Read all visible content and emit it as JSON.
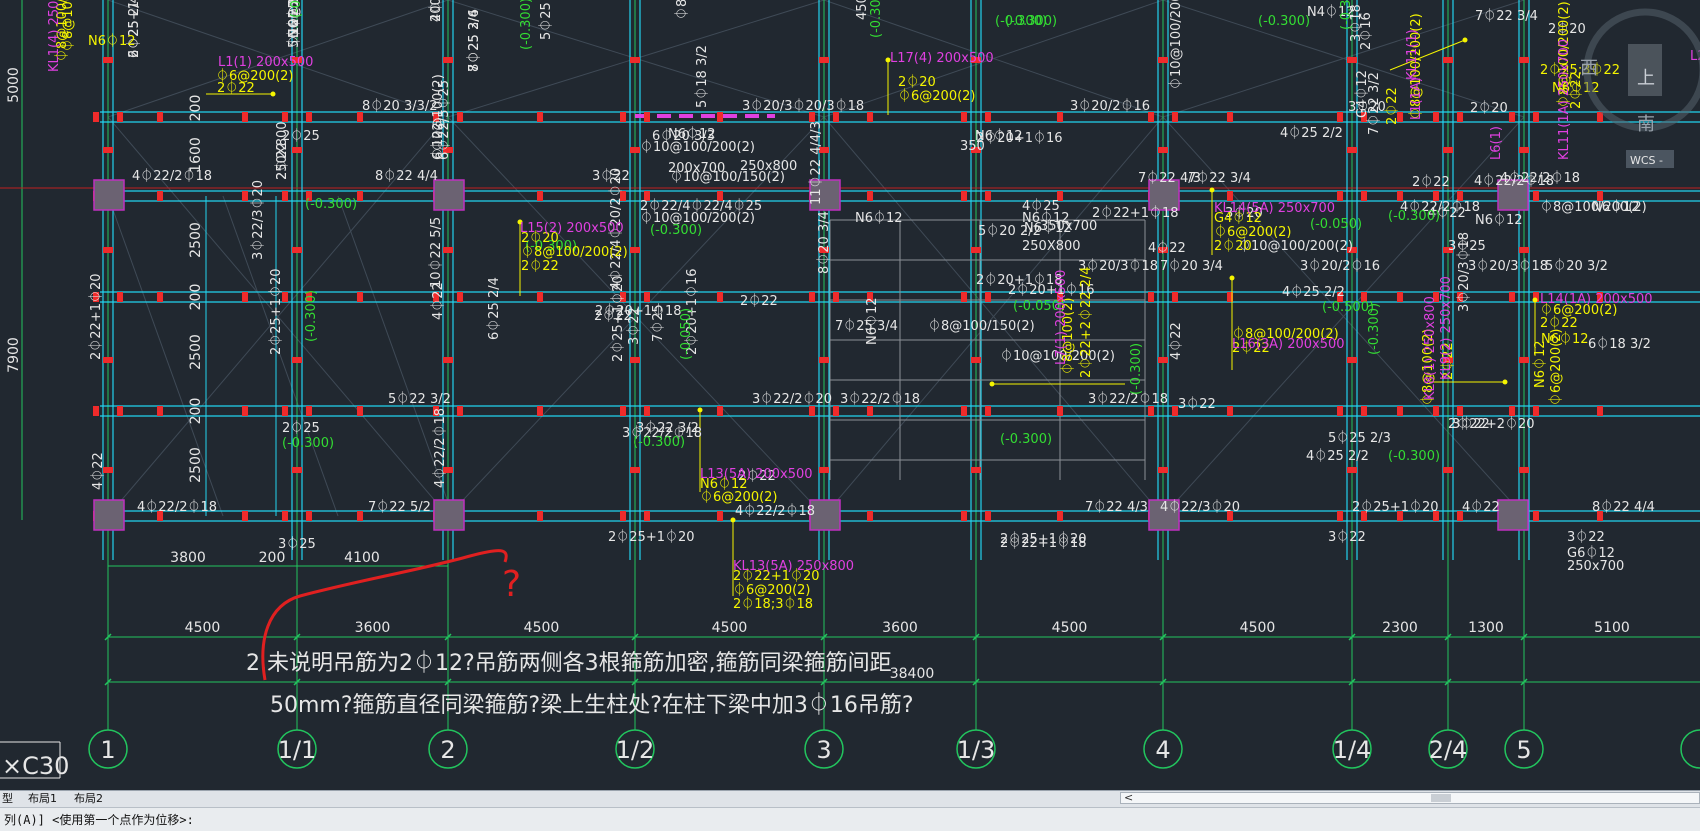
{
  "colors": {
    "bg": "#212830",
    "grid": "#22c55e",
    "beam": "#22d3ee",
    "rebar": "#ef2b2b",
    "column": "#6b6272",
    "column_border": "#c030c0",
    "white": "#e6e6e6",
    "green": "#33dd33",
    "yellow": "#f5f500",
    "magenta": "#e040e0",
    "annot": "#e02020"
  },
  "axes": {
    "labels": [
      "1",
      "1/1",
      "2",
      "1/2",
      "3",
      "1/3",
      "4",
      "1/4",
      "2/4",
      "5"
    ],
    "dims_bottom": [
      "4500",
      "3600",
      "4500",
      "4500",
      "3600",
      "4500",
      "4500",
      "2300",
      "1300",
      "5100"
    ],
    "total": "38400",
    "dims_mid": [
      "3800",
      "200",
      "4100"
    ],
    "left_dims": [
      "5000",
      "7900"
    ],
    "inner_dims": [
      "200",
      "1600",
      "2500",
      "200",
      "2500",
      "200",
      "2500"
    ]
  },
  "concrete": "×C30",
  "note": {
    "line1": "2.未说明吊筋为2⏀12?吊筋两侧各3根箍筋加密,箍筋同梁箍筋间距",
    "line2": "50mm?箍筋直径同梁箍筋?梁上生柱处?在柱下梁中加3⏀16吊筋?"
  },
  "handwriting": "?",
  "viewcube": {
    "west": "西",
    "south": "南",
    "up": "上",
    "wcs": "WCS -"
  },
  "rebar_labels": {
    "white": [
      "2⏀25+1⏀22",
      "5⏀25 2/3",
      "4⏀22",
      "8⏀25 2/6",
      "6⏀22",
      "5⏀25 2/3",
      "2⏀22",
      "8⏀20 3/3/2",
      "2⏀25",
      "4⏀22/2⏀18",
      "8⏀22 4/4",
      "6⏀22/5⏀25",
      "3⏀22",
      "6⏀20 3/3",
      "3⏀20/3⏀20/3⏀18",
      "5⏀18 3/2",
      "2⏀20+1⏀16",
      "350",
      "3⏀20/2⏀16",
      "7⏀22 4/3",
      "4⏀22/2⏀18",
      "7⏀22 3/4",
      "10⏀22 5/5",
      "3⏀22/3⏀20",
      "2⏀22/4⏀22/4⏀25",
      "11⏀22 4/4/3",
      "4⏀25",
      "N6⏀12",
      "250X800",
      "3⏀20/3⏀18",
      "7⏀20 3/4",
      "3⏀20/2⏀16",
      "5⏀20 3/2",
      "3⏀20/3⏀18",
      "2⏀22+1⏀20",
      "2⏀22",
      "4⏀22",
      "2⏀20+1⏀18",
      "2⏀20+1⏀16",
      "4⏀25 2/2",
      "6⏀18 3/2",
      "5⏀22 3/2",
      "2⏀25",
      "6⏀25 2/4",
      "7⏀25",
      "3⏀22",
      "3⏀22/2⏀20",
      "7⏀25 3/4",
      "3⏀22/2⏀18",
      "3⏀22/2⏀18",
      "3⏀22",
      "3⏀22",
      "2⏀22+2⏀20",
      "4⏀22",
      "4⏀22/2⏀18",
      "7⏀22 5/2",
      "4⏀22/2⏀18",
      "7⏀22 4/3",
      "4⏀22/2⏀18",
      "4⏀22/3⏀20",
      "5⏀25 2/3",
      "4⏀25 2/2",
      "3⏀25",
      "2⏀25+1⏀20",
      "2⏀22+1⏀18",
      "3⏀22",
      "4⏀22",
      "8⏀22 4/4",
      "3⏀22",
      "G6⏀12",
      "250x700",
      "2⏀20",
      "N6⏀12",
      "4⏀22/2⏀18",
      "N4⏀12",
      "3⏀18",
      "2⏀16",
      "G4⏀12",
      "3⏀20",
      "7⏀22 3/2",
      "⏀10@100/200(2)",
      "N6⏀12",
      "200x700",
      "⏀10@100/150(2)",
      "⏀10@100/200(2)",
      "⏀10@100/200(2)",
      "N6⏀12",
      "250x800",
      "4⏀22/4⏀20/2⏀20",
      "2⏀20+1⏀18",
      "3⏀22 3/2",
      "2⏀22",
      "2⏀22",
      "3⏀22/2⏀18",
      "2⏀25+1⏀20",
      "3⏀25",
      "2⏀22",
      "⏀10@100/200(2)",
      "8⏀20 3/4",
      "4⏀22",
      "3⏀20/3⏀18",
      "4⏀22",
      "2⏀25+1⏀20",
      "2⏀25+1⏀20",
      "2⏀25+1⏀20",
      "4⏀22/2⏀18",
      "2⏀22+1⏀18",
      "3⏀20",
      "4⏀22",
      "⏀8@100/200(2)",
      "N6⏀12",
      "4⏀25 2/2",
      "7⏀22 3/4",
      "2⏀20",
      "N6⏀12",
      "5⏀20 2/2",
      "N6⏀12",
      "5⏀25 2/3",
      "⏀8@100/200(4)",
      "450x700",
      "2⏀20+1⏀16",
      "⏀10@100/200(2)",
      "N6⏀12",
      "⏀8@100/150(2)",
      "350x700",
      "6⏀25 2/4",
      "⏀10@100/200(2)",
      "200x500",
      "7⏀25 3/4",
      "⏀10@100(2)",
      "N6⏀12",
      "250X800"
    ],
    "green": [
      "(-0.300)",
      "(-0.300)",
      "(-0.300)",
      "(-0.300)",
      "(-0.300)",
      "(-0.300)",
      "(-0.300)",
      "(-0.050)",
      "(-0.300)",
      "(-0.300)",
      "(-0.300)",
      "(-0.050)",
      "(-0.300)",
      "(-0.300)",
      "(-0.300)",
      "(-0.050)",
      "(-0.300)",
      "(-0.300)",
      "(-0.500)",
      "(-0.300)",
      "(-0.300)",
      "(-0.300)"
    ],
    "yellow": [
      "⏀8@100/200",
      "⏀8@100/150(2)",
      "N6⏀12",
      "⏀6@200(2)",
      "2⏀22",
      "2⏀20",
      "⏀6@200(2)",
      "2⏀20",
      "⏀8@100/200(2)",
      "2⏀22",
      "G4⏀12",
      "⏀6@200(2)",
      "2⏀20",
      "⏀6@200(2)",
      "2⏀22",
      "⏀8@100/200(2)",
      "2⏀22",
      "N6⏀12",
      "⏀6@200(2)",
      "2⏀22+1⏀20",
      "⏀6@200(2)",
      "2⏀18;3⏀18",
      "⏀8@100(2)",
      "2⏀22+2⏀22 2/4",
      "N6⏀12",
      "⏀8@100(2)",
      "2⏀22",
      "N6⏀12",
      "⏀6@200(2)",
      "2⏀22",
      "⏀8@100/200(2)",
      "2⏀25;3⏀22",
      "N6⏀12",
      "⏀8@100/200(2)",
      "2⏀22"
    ],
    "magenta": [
      "KL1(4) 250x",
      "L1(1) 200x500",
      "L17(4) 200x500",
      "L15(2) 200x500",
      "KL14(5A) 250x700",
      "L14(1A) 200x500",
      "L16(3A) 200x500",
      "L13(5A) 200x500",
      "KL13(5A) 250x800",
      "L7(1) 200x500",
      "KL8(1) 250x800",
      "KL9(2) 250x700",
      "L2(1) 200x500",
      "KL11(1A) 250x700",
      "L1(1A)",
      "KL11(1)",
      "L6(1)"
    ]
  },
  "ui": {
    "tabs": [
      "型",
      "布局1",
      "布局2"
    ],
    "command": "列(A)] <使用第一个点作为位移>:",
    "scroll_arrow": "<"
  }
}
